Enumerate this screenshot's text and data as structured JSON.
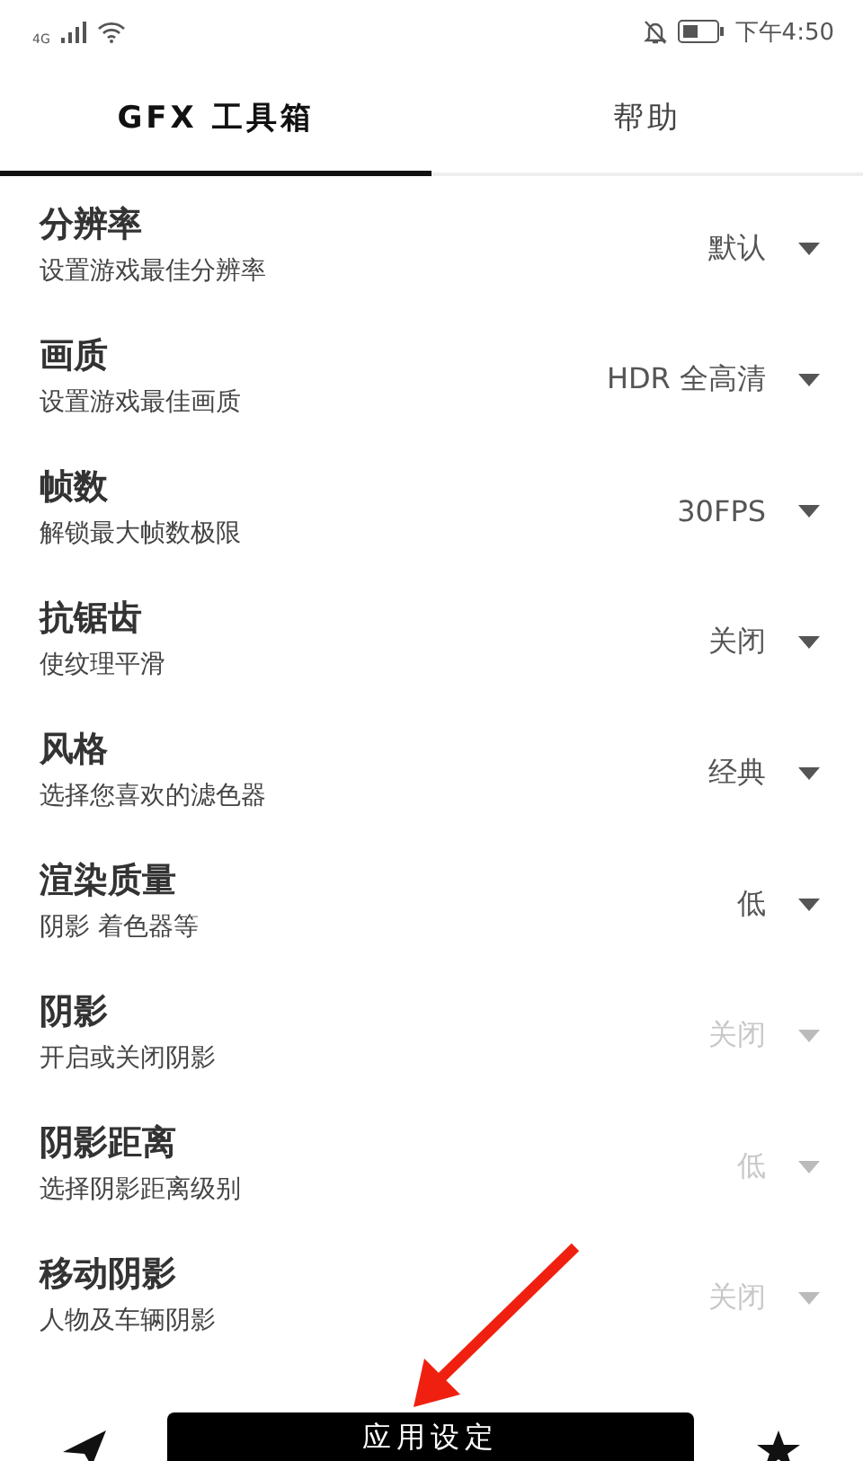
{
  "status_bar": {
    "network": "4G",
    "time": "下午4:50"
  },
  "tabs": [
    {
      "label": "GFX 工具箱",
      "selected": true
    },
    {
      "label": "帮助",
      "selected": false
    }
  ],
  "settings": [
    {
      "title": "分辨率",
      "subtitle": "设置游戏最佳分辨率",
      "value": "默认",
      "disabled": false
    },
    {
      "title": "画质",
      "subtitle": "设置游戏最佳画质",
      "value": "HDR 全高清",
      "disabled": false
    },
    {
      "title": "帧数",
      "subtitle": "解锁最大帧数极限",
      "value": "30FPS",
      "disabled": false
    },
    {
      "title": "抗锯齿",
      "subtitle": "使纹理平滑",
      "value": "关闭",
      "disabled": false
    },
    {
      "title": "风格",
      "subtitle": "选择您喜欢的滤色器",
      "value": "经典",
      "disabled": false
    },
    {
      "title": "渲染质量",
      "subtitle": "阴影 着色器等",
      "value": "低",
      "disabled": false
    },
    {
      "title": "阴影",
      "subtitle": "开启或关闭阴影",
      "value": "关闭",
      "disabled": true
    },
    {
      "title": "阴影距离",
      "subtitle": "选择阴影距离级别",
      "value": "低",
      "disabled": true
    },
    {
      "title": "移动阴影",
      "subtitle": "人物及车辆阴影",
      "value": "关闭",
      "disabled": true
    }
  ],
  "apply_button": "应用设定"
}
